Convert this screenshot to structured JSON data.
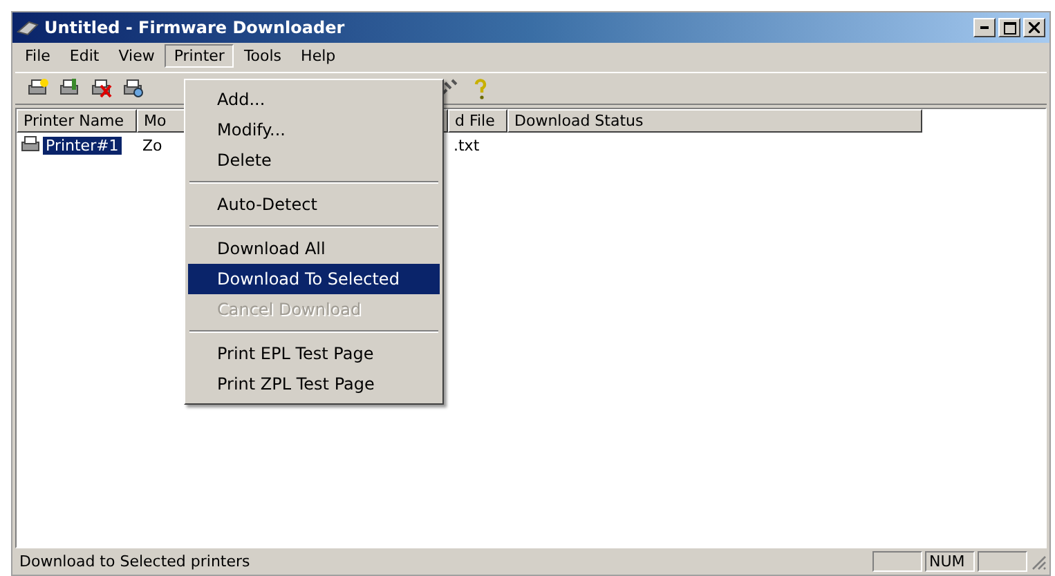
{
  "window": {
    "title": "Untitled - Firmware Downloader"
  },
  "menu_bar": [
    {
      "label": "File",
      "selected": false
    },
    {
      "label": "Edit",
      "selected": false
    },
    {
      "label": "View",
      "selected": false
    },
    {
      "label": "Printer",
      "selected": true
    },
    {
      "label": "Tools",
      "selected": false
    },
    {
      "label": "Help",
      "selected": false
    }
  ],
  "printer_menu": [
    {
      "kind": "item",
      "label": "Add...",
      "selected": false,
      "disabled": false
    },
    {
      "kind": "item",
      "label": "Modify...",
      "selected": false,
      "disabled": false
    },
    {
      "kind": "item",
      "label": "Delete",
      "selected": false,
      "disabled": false
    },
    {
      "kind": "separator"
    },
    {
      "kind": "item",
      "label": "Auto-Detect",
      "selected": false,
      "disabled": false
    },
    {
      "kind": "separator"
    },
    {
      "kind": "item",
      "label": "Download All",
      "selected": false,
      "disabled": false
    },
    {
      "kind": "item",
      "label": "Download To Selected",
      "selected": true,
      "disabled": false
    },
    {
      "kind": "item",
      "label": "Cancel Download",
      "selected": false,
      "disabled": true
    },
    {
      "kind": "separator"
    },
    {
      "kind": "item",
      "label": "Print EPL Test Page",
      "selected": false,
      "disabled": false
    },
    {
      "kind": "item",
      "label": "Print ZPL Test Page",
      "selected": false,
      "disabled": false
    }
  ],
  "table": {
    "columns": [
      "Printer Name",
      "Mo",
      "d File",
      "Download Status"
    ],
    "rows": [
      {
        "cells": [
          "Printer#1",
          "Zo",
          ".txt",
          ""
        ],
        "selected": true
      }
    ]
  },
  "status_bar": {
    "text": "Download to Selected printers",
    "panes": [
      {
        "kind": "empty"
      },
      {
        "kind": "text",
        "text": "NUM"
      },
      {
        "kind": "empty"
      }
    ]
  }
}
